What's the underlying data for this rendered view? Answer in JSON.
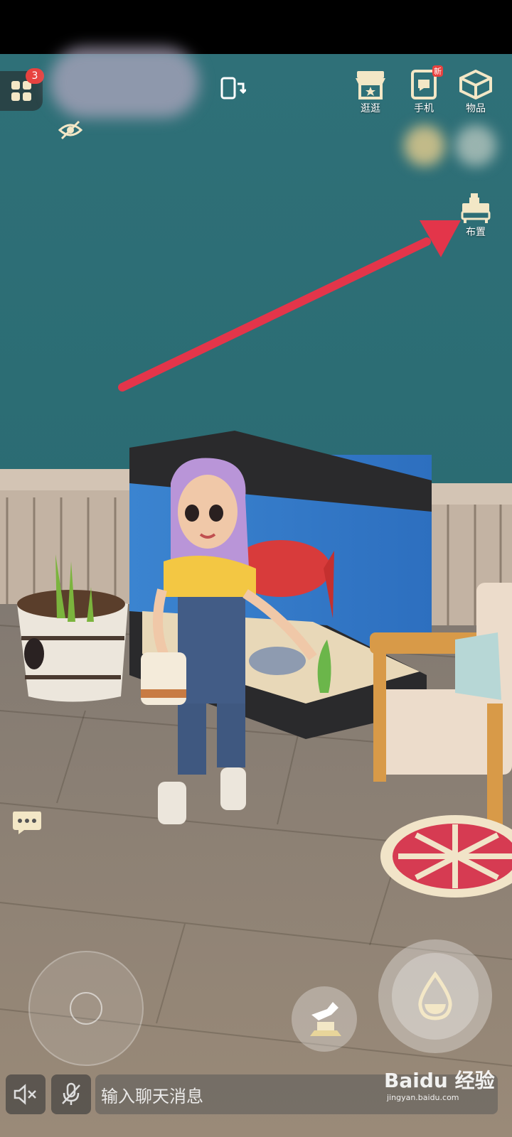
{
  "topbar": {
    "menu_badge_count": "3",
    "shop_label": "逛逛",
    "phone_label": "手机",
    "phone_new_tag": "新",
    "items_label": "物品",
    "decorate_label": "布置"
  },
  "bottombar": {
    "chat_placeholder": "输入聊天消息"
  },
  "watermark": {
    "brand": "Baidu",
    "brand_cn": "经验",
    "url": "jingyan.baidu.com"
  },
  "icons": {
    "menu": "grid-icon",
    "visibility": "eye-off-icon",
    "rotate": "rotate-screen-icon",
    "shop": "shop-icon",
    "phone": "phone-icon",
    "items": "box-icon",
    "decorate": "furniture-icon",
    "chat": "chat-bubble-icon",
    "mute": "speaker-muted-icon",
    "mic": "mic-off-icon",
    "watering": "watering-can-icon",
    "water_drop": "water-drop-icon"
  },
  "colors": {
    "wall": "#2e6f75",
    "floor": "#8d7f70",
    "arrow": "#e3354a",
    "badge": "#e8423f",
    "icon_cream": "#f3e7c6"
  }
}
